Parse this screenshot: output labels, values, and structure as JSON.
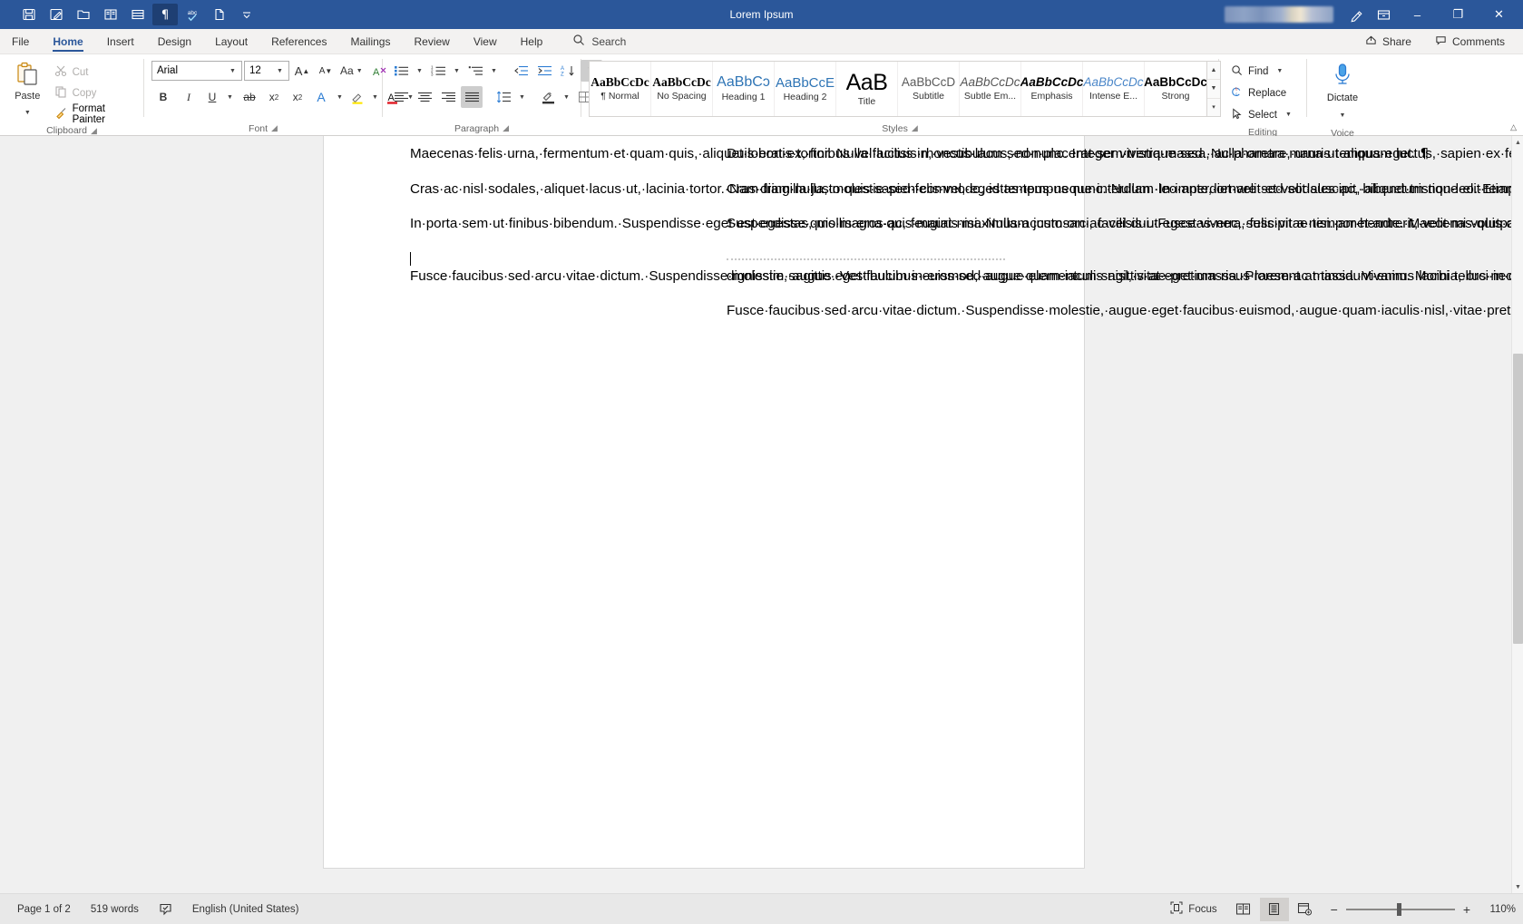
{
  "titlebar": {
    "document_title": "Lorem Ipsum",
    "quick_access": [
      {
        "name": "save-icon",
        "label": "Save",
        "active": false
      },
      {
        "name": "autosave-icon",
        "label": "Save As",
        "active": false
      },
      {
        "name": "open-folder-icon",
        "label": "Open",
        "active": false
      },
      {
        "name": "book-view-icon",
        "label": "Read Mode",
        "active": false
      },
      {
        "name": "table-icon",
        "label": "Insert Table",
        "active": false
      },
      {
        "name": "pilcrow-icon",
        "label": "Show/Hide Formatting Marks",
        "active": true
      },
      {
        "name": "spelling-check-icon",
        "label": "Spelling & Grammar",
        "active": false
      },
      {
        "name": "new-document-icon",
        "label": "New",
        "active": false
      },
      {
        "name": "customize-qat-icon",
        "label": "Customize Quick Access Toolbar",
        "active": false
      }
    ],
    "account_redacted": true,
    "window_controls": {
      "pen_icon": "draw-icon",
      "ribbon_display_icon": "ribbon-display-options-icon",
      "minimize": "–",
      "maximize": "❐",
      "close": "✕"
    }
  },
  "tabs": [
    {
      "label": "File",
      "active": false
    },
    {
      "label": "Home",
      "active": true
    },
    {
      "label": "Insert",
      "active": false
    },
    {
      "label": "Design",
      "active": false
    },
    {
      "label": "Layout",
      "active": false
    },
    {
      "label": "References",
      "active": false
    },
    {
      "label": "Mailings",
      "active": false
    },
    {
      "label": "Review",
      "active": false
    },
    {
      "label": "View",
      "active": false
    },
    {
      "label": "Help",
      "active": false
    }
  ],
  "search": {
    "label": "Search",
    "placeholder": "Search"
  },
  "tabbar_right": {
    "share_label": "Share",
    "comments_label": "Comments"
  },
  "ribbon": {
    "clipboard": {
      "group_label": "Clipboard",
      "paste_label": "Paste",
      "cut_label": "Cut",
      "copy_label": "Copy",
      "format_painter_label": "Format Painter"
    },
    "font": {
      "group_label": "Font",
      "font_family_value": "Arial",
      "font_size_value": "12",
      "grow_font": "A",
      "shrink_font": "A",
      "change_case": "Aa",
      "clear_formatting": "A",
      "bold": "B",
      "italic": "I",
      "underline": "U",
      "strikethrough": "ab",
      "subscript": "x",
      "superscript": "x",
      "text_effects": "A",
      "highlight": "A",
      "font_color": "A"
    },
    "paragraph": {
      "group_label": "Paragraph",
      "bullets": "bullets-icon",
      "numbering": "numbering-icon",
      "multilevel": "multilevel-list-icon",
      "decrease_indent": "decrease-indent-icon",
      "increase_indent": "increase-indent-icon",
      "sort": "sort-icon",
      "show_marks": "pilcrow-icon",
      "align_left": "align-left-icon",
      "align_center": "align-center-icon",
      "align_right": "align-right-icon",
      "justify": "justify-icon",
      "justify_active": true,
      "line_spacing": "line-spacing-icon",
      "shading": "shading-icon",
      "borders": "borders-icon"
    },
    "styles": {
      "group_label": "Styles",
      "items": [
        {
          "preview": "AaBbCcDc",
          "name": "¶ Normal",
          "style": "normal"
        },
        {
          "preview": "AaBbCcDc",
          "name": "No Spacing",
          "style": "nospacing"
        },
        {
          "preview": "AaBbCɔ",
          "name": "Heading 1",
          "style": "h1"
        },
        {
          "preview": "AaBbCcE",
          "name": "Heading 2",
          "style": "h2"
        },
        {
          "preview": "AaB",
          "name": "Title",
          "style": "title"
        },
        {
          "preview": "AaBbCcD",
          "name": "Subtitle",
          "style": "subtitle"
        },
        {
          "preview": "AaBbCcDc",
          "name": "Subtle Em...",
          "style": "subtleem"
        },
        {
          "preview": "AaBbCcDc",
          "name": "Emphasis",
          "style": "emphasis"
        },
        {
          "preview": "AaBbCcDc",
          "name": "Intense E...",
          "style": "intense"
        },
        {
          "preview": "AaBbCcDc",
          "name": "Strong",
          "style": "strong"
        }
      ]
    },
    "editing": {
      "group_label": "Editing",
      "find_label": "Find",
      "replace_label": "Replace",
      "select_label": "Select"
    },
    "voice": {
      "group_label": "Voice",
      "dictate_label": "Dictate"
    }
  },
  "document": {
    "left_column": [
      "Maecenas felis urna, fermentum et quam quis, aliquet lobortis tortor. Nulla facilisis rhoncus lacus, non placerat sem tristique sed. Nulla ornare, urna ut aliquam luctus, sapien ex feugiat augue, quis porttitor neque dui at neque.",
      "Cras ac nisl sodales, aliquet lacus ut, lacinia tortor. Nam fringilla justo quis sapien commodo, id tempus neque interdum. In imperdiet velit et velit suscipit, aliquet tristique elit tempor. Donec viverra sapien augue, et fermentum nibh consectetur vitae. Donec aliquet consectetur malesuada. Proin a lorem justo.",
      "In porta sem ut finibus bibendum. Suspendisse eget est egestas, mollis eros ac, feugiat nisi. Nullam justo orci, facilisis ut egestas nec, suscipit a nisi. amet ante. Maecenas quis dignissim ex. Aliquam eget commodo neque. In nec cursus eros. Nunc quam, mattis eget dictum in, sodales ac ligula. Cras iaculis sem vitae tortor rutrum semper. Nulla volutpat tempor nibh, at scelerisque diam lacinia et. Nunc at eros diam. Pellentesque odio massa, volutpat non massa eget, gravida tempus quam. Proin consectetur convallis molestie.",
      "Fusce faucibus sed arcu vitae dictum. Suspendisse molestie, augue eget faucibus euismod, augue quam iaculis nisl, vitae pretium risus lorem ac massa. Vivamus lacinia, orci in dictum mollis, purus rhoncus urna, et feugiat augue ligula lacinia ex. Pellentesque hendrerit porttitor eros, sed dictum massa"
    ],
    "right_column": [
      "Duis erat ex, finibus vel luctus in, vestibulum sed nunc. Integer viverra massa, ac pharetra mauris tempus eget.",
      "Cras diam nulla, molestie sed felis vel, egestas tempus nunc. Nullam leo ante, ornare sed sodales ac, bibendum non leo. Etiam volutpat vehicula ligula, non tristique turpis blandit non. Nam quis pulvinar velit, nec pulvinar ligula. Vestibulum efficitur bibendum nibh, ut mattis sem varius nec. Orci varius natoque penatibus et magnis dis parturient montes, nascetur ridiculus mus. In tempus varius tincidunt.",
      "Suspendisse quis magna quis mauris maximus accumsan ac vel dui. Fusce viverra, felis vitae tempor hendrerit, velit mi volutpat risus, in hendrerit nisl ex sit",
      "dignissim sagittis. Vestibulum in eros sed augue elementum sagittis at eget massa. Praesent at tincidunt enim. Morbi tellus neque, lacinia et diam vitae, dictum tempus dolor. Donec maximus, orci ut porta rutrum, mi metus feugiat felis, in sodales tortor magna eu tellus. Aenean iaculis eleifend velit ut luctus.",
      "Fusce faucibus sed arcu vitae dictum. Suspendisse molestie, augue eget faucibus euismod, augue quam iaculis nisl, vitae pretium risus lorem ac massa. Vivamus lacinia, orci in dictum mollis, purus rhoncus urna, et feugiat augue ligula lacinia ex. Pellentesque hendrerit porttitor eros, sed dictum massa dignissim sagittis. Vestibulum in eros sed augue elementum sagittis at eget massa."
    ]
  },
  "statusbar": {
    "page_label": "Page 1 of 2",
    "word_count": "519 words",
    "proofing_icon": "proofing-errors-icon",
    "language": "English (United States)",
    "focus_label": "Focus",
    "view_read": "read-mode-icon",
    "view_print": "print-layout-icon",
    "view_web": "web-layout-icon",
    "zoom_out": "−",
    "zoom_in": "+",
    "zoom_level": "110%"
  },
  "colors": {
    "title_bar": "#2b579a",
    "accent": "#2b579a",
    "ribbon_bg": "#ffffff",
    "status_bg": "#e8e8e8",
    "doc_bg": "#f0f0f0"
  }
}
